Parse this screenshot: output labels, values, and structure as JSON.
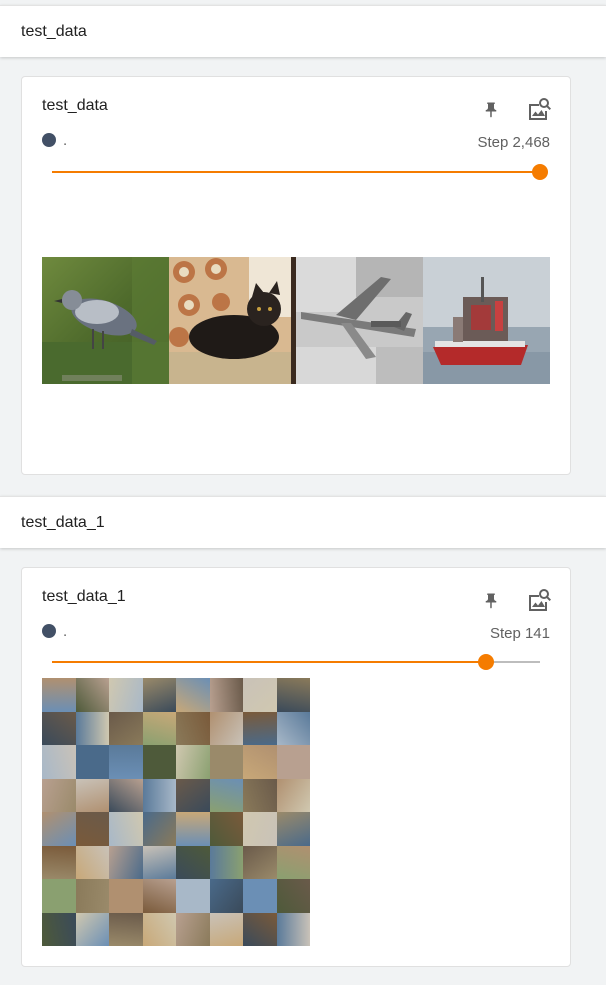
{
  "groups": [
    {
      "header": "test_data",
      "card": {
        "title": "test_data",
        "run_label": ".",
        "run_color": "#425066",
        "step_text": "Step 2,468",
        "slider_fraction": 1.0,
        "accent": "#f57c00",
        "images": [
          "bird",
          "cat",
          "airplane",
          "ship"
        ]
      }
    },
    {
      "header": "test_data_1",
      "card": {
        "title": "test_data_1",
        "run_label": ".",
        "run_color": "#425066",
        "step_text": "Step 141",
        "slider_fraction": 0.89,
        "accent": "#f57c00",
        "grid_rows": 8,
        "grid_cols": 8
      }
    }
  ],
  "icons": {
    "pin": "pin-icon",
    "expand": "image-search-icon"
  }
}
